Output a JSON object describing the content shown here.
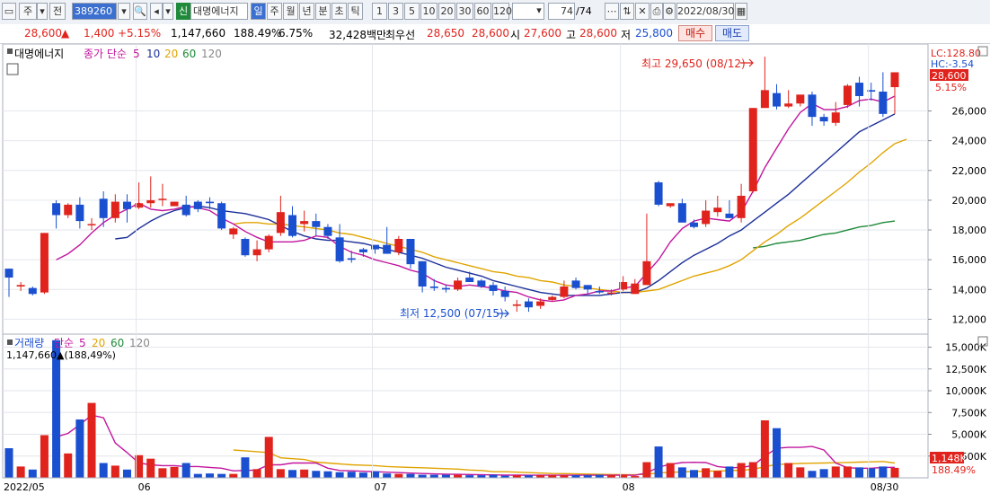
{
  "toolbar": {
    "market": "주",
    "mode": "전",
    "code": "389260",
    "sin_badge": "신",
    "stock_name": "대명에너지",
    "periods": [
      "일",
      "주",
      "월",
      "년",
      "분",
      "초",
      "틱"
    ],
    "active_period": "일",
    "intervals": [
      "1",
      "3",
      "5",
      "10",
      "20",
      "30",
      "60",
      "120"
    ],
    "count_display": "74",
    "count_total": "/74",
    "date": "2022/08/30"
  },
  "quote": {
    "price": "28,600",
    "change": "1,400",
    "change_pct": "+5.15%",
    "volume": "1,147,660",
    "vol_ratio": "188.49%",
    "turnover": "6.75%",
    "amount": "32,428백만",
    "best_label": "최우선",
    "ask": "28,650",
    "bid": "28,600",
    "open_label": "시",
    "open": "27,600",
    "high_label": "고",
    "high": "28,600",
    "low_label": "저",
    "low": "25,800",
    "buy": "매수",
    "sell": "매도"
  },
  "colors": {
    "up": "#e0231c",
    "down": "#1a4fd0",
    "ma5": "#c2169e",
    "ma10": "#1c2f98",
    "ma20": "#e0a400",
    "ma60": "#1f8a3a"
  },
  "chart_data": [
    {
      "type": "candlestick",
      "legend": {
        "name": "대명에너지",
        "ma_label": "종가 단순",
        "ma": [
          "5",
          "10",
          "20",
          "60",
          "120"
        ]
      },
      "right_labels": {
        "lc": "LC:128.80",
        "hc": "HC:-3.54",
        "price": "28,600",
        "pct": "5.15%"
      },
      "annotations": {
        "high": "최고 29,650 (08/12)",
        "low": "최저 12,500 (07/15)"
      },
      "ylim": [
        11000,
        30500
      ],
      "yticks": [
        "26,000",
        "24,000",
        "22,000",
        "20,000",
        "18,000",
        "16,000",
        "14,000",
        "12,000"
      ],
      "ytick_values": [
        26000,
        24000,
        22000,
        20000,
        18000,
        16000,
        14000,
        12000
      ],
      "xlabels": [
        "2022/05",
        "06",
        "07",
        "08",
        "08/30"
      ],
      "xlabel_index": [
        0,
        11,
        31,
        52,
        73
      ],
      "candles": [
        [
          15400,
          14800,
          13500,
          15400
        ],
        [
          14200,
          14300,
          13900,
          14500
        ],
        [
          14100,
          13700,
          13600,
          14200
        ],
        [
          13800,
          17800,
          13700,
          17800
        ],
        [
          19800,
          19000,
          18100,
          20000
        ],
        [
          19000,
          19700,
          18800,
          19800
        ],
        [
          19700,
          18600,
          18100,
          20200
        ],
        [
          18400,
          18400,
          18000,
          18800
        ],
        [
          20100,
          18800,
          18200,
          20600
        ],
        [
          18800,
          19900,
          18500,
          20400
        ],
        [
          19900,
          19400,
          18500,
          20400
        ],
        [
          19500,
          19800,
          19400,
          21200
        ],
        [
          19800,
          20000,
          19500,
          21600
        ],
        [
          20100,
          20100,
          19600,
          21100
        ],
        [
          19600,
          19900,
          19600,
          19900
        ],
        [
          19700,
          19000,
          18900,
          20300
        ],
        [
          19900,
          19400,
          19200,
          20000
        ],
        [
          19900,
          19800,
          19400,
          20200
        ],
        [
          19800,
          18100,
          18000,
          19900
        ],
        [
          17700,
          18100,
          17400,
          18200
        ],
        [
          17400,
          16300,
          16200,
          17500
        ],
        [
          16300,
          16700,
          15900,
          17300
        ],
        [
          16700,
          17600,
          16500,
          17700
        ],
        [
          17800,
          19200,
          17600,
          20300
        ],
        [
          19000,
          17600,
          17500,
          19600
        ],
        [
          18400,
          18600,
          17900,
          19300
        ],
        [
          18600,
          18200,
          17600,
          19100
        ],
        [
          18200,
          17600,
          17400,
          18400
        ],
        [
          17500,
          15900,
          15800,
          18400
        ],
        [
          16100,
          16000,
          15800,
          16600
        ],
        [
          16700,
          16500,
          16200,
          16800
        ],
        [
          17000,
          16700,
          16400,
          16900
        ],
        [
          17000,
          16400,
          16400,
          18200
        ],
        [
          16500,
          17400,
          16300,
          17600
        ],
        [
          17400,
          15700,
          15400,
          17400
        ],
        [
          15900,
          14200,
          13800,
          15900
        ],
        [
          14200,
          14100,
          13900,
          14700
        ],
        [
          14100,
          14000,
          13800,
          14300
        ],
        [
          14000,
          14600,
          13900,
          14800
        ],
        [
          14800,
          14500,
          14500,
          15200
        ],
        [
          14600,
          14200,
          14100,
          14700
        ],
        [
          14300,
          13900,
          13600,
          14500
        ],
        [
          13900,
          13500,
          13200,
          14200
        ],
        [
          12900,
          13000,
          12500,
          13300
        ],
        [
          13200,
          12800,
          12500,
          13400
        ],
        [
          12900,
          13200,
          12700,
          13400
        ],
        [
          13300,
          13500,
          13200,
          13600
        ],
        [
          13500,
          14200,
          13400,
          14600
        ],
        [
          14600,
          14100,
          14000,
          14800
        ],
        [
          14300,
          14000,
          13700,
          14300
        ],
        [
          13900,
          13800,
          13700,
          14200
        ],
        [
          13800,
          13800,
          13600,
          14000
        ],
        [
          14000,
          14500,
          13900,
          14900
        ],
        [
          13700,
          14400,
          13700,
          14700
        ],
        [
          14300,
          15900,
          14300,
          19100
        ],
        [
          21200,
          19700,
          19600,
          21300
        ],
        [
          19600,
          19800,
          19500,
          19700
        ],
        [
          19800,
          18500,
          18500,
          20100
        ],
        [
          18500,
          18200,
          18100,
          18700
        ],
        [
          18400,
          19300,
          18200,
          20000
        ],
        [
          19200,
          19500,
          18900,
          20300
        ],
        [
          19100,
          18800,
          18800,
          20000
        ],
        [
          18800,
          20300,
          18500,
          21100
        ],
        [
          20600,
          26200,
          20500,
          26200
        ],
        [
          26200,
          27400,
          26600,
          29650
        ],
        [
          27200,
          26300,
          26100,
          27800
        ],
        [
          26300,
          26500,
          26200,
          27400
        ],
        [
          26500,
          27100,
          26300,
          26800
        ],
        [
          27100,
          25600,
          25000,
          27300
        ],
        [
          25600,
          25300,
          25000,
          25800
        ],
        [
          25200,
          25900,
          25000,
          26600
        ],
        [
          26400,
          27700,
          26200,
          27800
        ],
        [
          27900,
          27000,
          26300,
          28300
        ],
        [
          27400,
          27300,
          26700,
          27900
        ],
        [
          27300,
          25800,
          25600,
          28600
        ],
        [
          27600,
          28600,
          25800,
          28600
        ]
      ],
      "ma5": [
        null,
        null,
        null,
        null,
        16000,
        16400,
        17000,
        17800,
        18500,
        19000,
        19400,
        19800,
        19400,
        19300,
        19400,
        19600,
        19500,
        19300,
        18800,
        18400,
        17900,
        17500,
        17200,
        17200,
        17200,
        17300,
        17600,
        17500,
        16900,
        16500,
        16300,
        16000,
        15800,
        15600,
        15300,
        15100,
        14600,
        14300,
        14200,
        14300,
        14200,
        14100,
        13900,
        13800,
        13500,
        13300,
        13200,
        13300,
        13600,
        13700,
        13900,
        13900,
        14100,
        14200,
        15100,
        16000,
        17200,
        18100,
        18600,
        18800,
        18700,
        18600,
        19200,
        20600,
        22200,
        23500,
        24800,
        25900,
        26500,
        26100,
        26100,
        26300,
        26700,
        26800,
        26600,
        27000
      ],
      "ma10": [
        null,
        null,
        null,
        null,
        null,
        null,
        null,
        null,
        null,
        17400,
        17500,
        18100,
        18600,
        19000,
        19300,
        19500,
        19600,
        19500,
        19300,
        19200,
        19100,
        18900,
        18700,
        18300,
        17900,
        17600,
        17400,
        17300,
        17300,
        17200,
        17100,
        16900,
        16700,
        16500,
        16300,
        16100,
        15800,
        15500,
        15300,
        15100,
        14900,
        14600,
        14400,
        14200,
        14000,
        13800,
        13700,
        13600,
        13600,
        13600,
        13600,
        13700,
        13800,
        13800,
        14100,
        14600,
        15200,
        15800,
        16300,
        16700,
        17100,
        17600,
        18000,
        18600,
        19200,
        19800,
        20400,
        21100,
        21800,
        22500,
        23200,
        23900,
        24600,
        25000,
        25400,
        25800
      ],
      "ma20": [
        null,
        null,
        null,
        null,
        null,
        null,
        null,
        null,
        null,
        null,
        null,
        null,
        null,
        null,
        null,
        null,
        null,
        null,
        null,
        18400,
        18500,
        18500,
        18400,
        18400,
        18300,
        18200,
        18100,
        18000,
        17800,
        17700,
        17500,
        17300,
        17100,
        16900,
        16700,
        16500,
        16200,
        16000,
        15800,
        15600,
        15400,
        15200,
        15100,
        14900,
        14800,
        14600,
        14500,
        14300,
        14200,
        14100,
        14000,
        13900,
        13800,
        13800,
        13900,
        14000,
        14300,
        14600,
        14900,
        15100,
        15300,
        15600,
        16000,
        16600,
        17200,
        17700,
        18300,
        18800,
        19400,
        20000,
        20600,
        21200,
        21900,
        22500,
        23200,
        23800,
        24100
      ],
      "ma60": [
        null,
        null,
        null,
        null,
        null,
        null,
        null,
        null,
        null,
        null,
        null,
        null,
        null,
        null,
        null,
        null,
        null,
        null,
        null,
        null,
        null,
        null,
        null,
        null,
        null,
        null,
        null,
        null,
        null,
        null,
        null,
        null,
        null,
        null,
        null,
        null,
        null,
        null,
        null,
        null,
        null,
        null,
        null,
        null,
        null,
        null,
        null,
        null,
        null,
        null,
        null,
        null,
        null,
        null,
        null,
        null,
        null,
        null,
        null,
        null,
        null,
        null,
        null,
        16800,
        16900,
        17100,
        17200,
        17300,
        17500,
        17700,
        17800,
        18000,
        18200,
        18300,
        18500,
        18600
      ]
    },
    {
      "type": "bar",
      "legend": {
        "name": "거래량",
        "ma_label": "단순",
        "ma": [
          "5",
          "20",
          "60",
          "120"
        ]
      },
      "header_text": "1,147,660▲(188,49%)",
      "right_labels": {
        "vol": "1,148K",
        "pct": "188.49%"
      },
      "ylim": [
        0,
        16500
      ],
      "yticks": [
        "15,000K",
        "12,500K",
        "10,000K",
        "7,500K",
        "5,000K",
        "2,500K"
      ],
      "ytick_values": [
        15000,
        12500,
        10000,
        7500,
        5000,
        2500
      ],
      "unit": "K",
      "values": [
        3400,
        1300,
        950,
        4900,
        15800,
        2800,
        6700,
        8600,
        1700,
        1400,
        950,
        2600,
        2200,
        1100,
        1250,
        1700,
        450,
        500,
        450,
        450,
        2350,
        1000,
        4700,
        1000,
        900,
        950,
        800,
        750,
        650,
        700,
        600,
        750,
        500,
        450,
        450,
        350,
        350,
        350,
        350,
        300,
        300,
        350,
        250,
        300,
        300,
        300,
        300,
        300,
        300,
        300,
        350,
        300,
        350,
        200,
        1800,
        3600,
        1700,
        1200,
        900,
        1100,
        800,
        1300,
        1700,
        1800,
        6600,
        5700,
        1700,
        1200,
        800,
        1000,
        1300,
        1300,
        1200,
        1100,
        1300,
        1148
      ],
      "ma5": [
        null,
        null,
        null,
        null,
        4700,
        5100,
        6100,
        7200,
        6900,
        4000,
        2900,
        1700,
        1500,
        1400,
        1400,
        1300,
        1300,
        1200,
        1100,
        800,
        850,
        900,
        1500,
        1500,
        1700,
        1700,
        1700,
        1100,
        850,
        800,
        750,
        700,
        650,
        600,
        550,
        500,
        450,
        420,
        400,
        380,
        350,
        340,
        320,
        310,
        300,
        300,
        300,
        300,
        300,
        300,
        300,
        300,
        320,
        290,
        560,
        1240,
        1560,
        1750,
        1780,
        1750,
        1300,
        1150,
        1200,
        1400,
        2500,
        3400,
        3500,
        3500,
        3600,
        3200,
        1700,
        1150,
        1100,
        1100,
        1200,
        1210
      ],
      "ma20": [
        null,
        null,
        null,
        null,
        null,
        null,
        null,
        null,
        null,
        null,
        null,
        null,
        null,
        null,
        null,
        null,
        null,
        null,
        null,
        3200,
        3100,
        3000,
        2900,
        2300,
        2200,
        2100,
        1800,
        1700,
        1600,
        1500,
        1450,
        1400,
        1300,
        1250,
        1200,
        1150,
        1100,
        1050,
        1000,
        900,
        850,
        700,
        700,
        650,
        600,
        550,
        500,
        480,
        450,
        430,
        400,
        380,
        370,
        350,
        420,
        560,
        630,
        690,
        720,
        760,
        780,
        820,
        880,
        960,
        1300,
        1530,
        1600,
        1650,
        1680,
        1700,
        1730,
        1760,
        1800,
        1840,
        1880,
        1700
      ]
    }
  ]
}
